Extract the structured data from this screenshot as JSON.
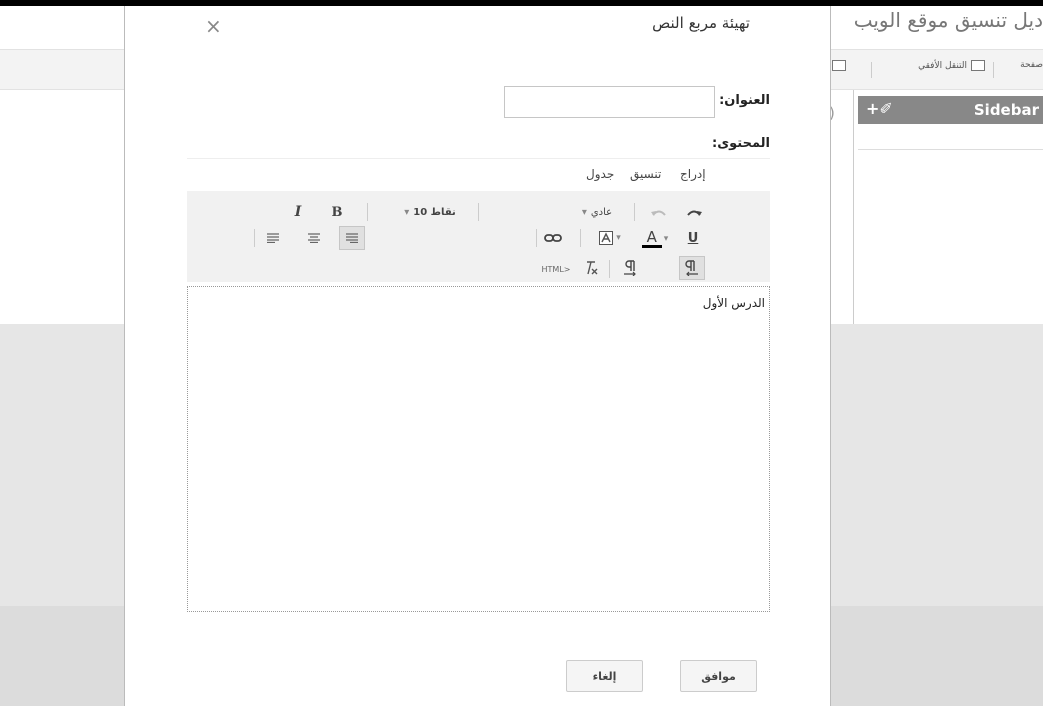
{
  "background": {
    "title": "دیل تنسیق موقع الویب",
    "toolbar": {
      "page_label": "صفحة",
      "horizontal_nav_label": "التنقل الأفقي"
    },
    "sidebar": {
      "label": "Sidebar",
      "actions": "+✐"
    }
  },
  "dialog": {
    "title": "تهيئة مربع النص",
    "close_symbol": "×",
    "title_label": "العنوان:",
    "title_value": "",
    "content_label": "المحتوى:",
    "menu": [
      "إدراج",
      "تنسيق",
      "جدول"
    ],
    "toolbar": {
      "bold": "B",
      "italic": "I",
      "font_size": "10 نقاط",
      "font_size_arrow": "▾",
      "paragraph_style": "عادي",
      "paragraph_style_arrow": "▾",
      "underline": "U",
      "font_color": "A",
      "font_color_arrow": "▾",
      "highlight_arrow": "▾",
      "html_label": "HTML>"
    },
    "editor_text": "الدرس الأول",
    "ok_label": "موافق",
    "cancel_label": "إلغاء"
  },
  "colors": {
    "sidebar_header_bg": "#888888",
    "modal_overlay_gray": "#e6e6e6",
    "toolbar_bg": "#f1f1f1"
  }
}
